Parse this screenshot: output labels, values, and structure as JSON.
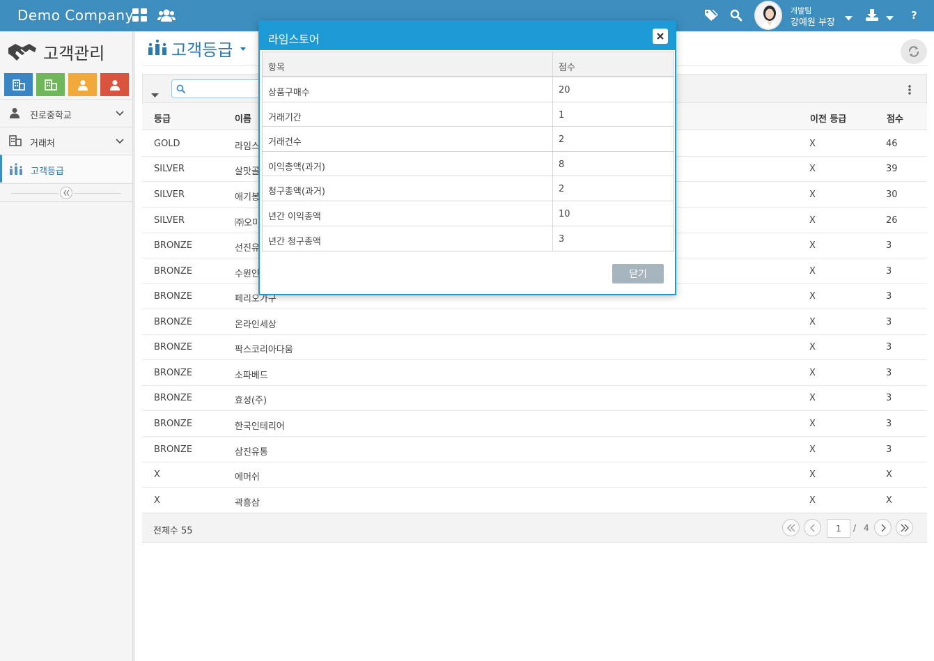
{
  "header": {
    "brand": "Demo Company",
    "user_team": "개발팀",
    "user_name": "강예원 부장"
  },
  "sidebar": {
    "app_title": "고객관리",
    "quick_buttons": [
      {
        "color": "#3a86c4",
        "icon": "building-icon"
      },
      {
        "color": "#6fb75a",
        "icon": "building-icon"
      },
      {
        "color": "#f2a93b",
        "icon": "person-icon"
      },
      {
        "color": "#d9533f",
        "icon": "person-icon"
      }
    ],
    "items": [
      {
        "label": "진로중학교",
        "icon": "person-icon"
      },
      {
        "label": "거래처",
        "icon": "building-icon"
      },
      {
        "label": "고객등급",
        "icon": "grade-icon"
      }
    ]
  },
  "page": {
    "title": "고객등급"
  },
  "grid": {
    "columns": {
      "grade": "등급",
      "name": "이름",
      "prev_grade": "이전 등급",
      "score": "점수"
    },
    "rows": [
      {
        "grade": "GOLD",
        "name": "라임스",
        "prev": "X",
        "score": "46"
      },
      {
        "grade": "SILVER",
        "name": "살맛골",
        "prev": "X",
        "score": "39"
      },
      {
        "grade": "SILVER",
        "name": "애기봉",
        "prev": "X",
        "score": "30"
      },
      {
        "grade": "SILVER",
        "name": "㈜오미",
        "prev": "X",
        "score": "26"
      },
      {
        "grade": "BRONZE",
        "name": "선진유",
        "prev": "X",
        "score": "3"
      },
      {
        "grade": "BRONZE",
        "name": "수원인",
        "prev": "X",
        "score": "3"
      },
      {
        "grade": "BRONZE",
        "name": "페리오가구",
        "prev": "X",
        "score": "3"
      },
      {
        "grade": "BRONZE",
        "name": "온라인세상",
        "prev": "X",
        "score": "3"
      },
      {
        "grade": "BRONZE",
        "name": "팍스코리아다움",
        "prev": "X",
        "score": "3"
      },
      {
        "grade": "BRONZE",
        "name": "소파베드",
        "prev": "X",
        "score": "3"
      },
      {
        "grade": "BRONZE",
        "name": "효성(주)",
        "prev": "X",
        "score": "3"
      },
      {
        "grade": "BRONZE",
        "name": "한국인테리어",
        "prev": "X",
        "score": "3"
      },
      {
        "grade": "BRONZE",
        "name": "삼진유통",
        "prev": "X",
        "score": "3"
      },
      {
        "grade": "X",
        "name": "에머쉬",
        "prev": "X",
        "score": "X"
      },
      {
        "grade": "X",
        "name": "곽흥삼",
        "prev": "X",
        "score": "X"
      }
    ],
    "total_label": "전체수 55",
    "page_current": "1",
    "page_sep": "/",
    "page_total": "4"
  },
  "modal": {
    "title": "라임스토어",
    "col_item": "항목",
    "col_score": "점수",
    "rows": [
      {
        "item": "상품구매수",
        "score": "20"
      },
      {
        "item": "거래기간",
        "score": "1"
      },
      {
        "item": "거래건수",
        "score": "2"
      },
      {
        "item": "이익총액(과거)",
        "score": "8"
      },
      {
        "item": "청구총액(과거)",
        "score": "2"
      },
      {
        "item": "년간 이익총액",
        "score": "10"
      },
      {
        "item": "년간 청구총액",
        "score": "3"
      }
    ],
    "close_label": "닫기"
  }
}
